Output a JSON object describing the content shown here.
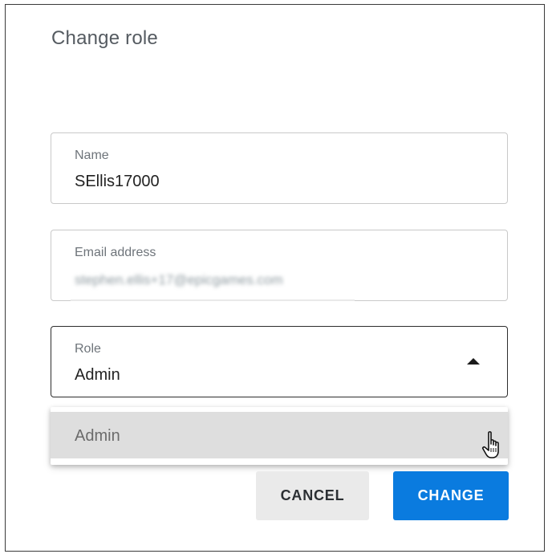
{
  "dialog": {
    "title": "Change role"
  },
  "fields": {
    "name": {
      "label": "Name",
      "value": "SEllis17000"
    },
    "email": {
      "label": "Email address",
      "value": "stephen.ellis+17@epicgames.com"
    },
    "role": {
      "label": "Role",
      "value": "Admin"
    }
  },
  "dropdown": {
    "options": [
      "Admin"
    ]
  },
  "buttons": {
    "cancel": "CANCEL",
    "change": "CHANGE"
  },
  "colors": {
    "primary": "#0a7bdf",
    "secondary_button": "#eaeaea",
    "highlight": "#dedede"
  },
  "icons": {
    "caret": "caret-up-icon",
    "cursor": "hand-pointer-icon"
  }
}
